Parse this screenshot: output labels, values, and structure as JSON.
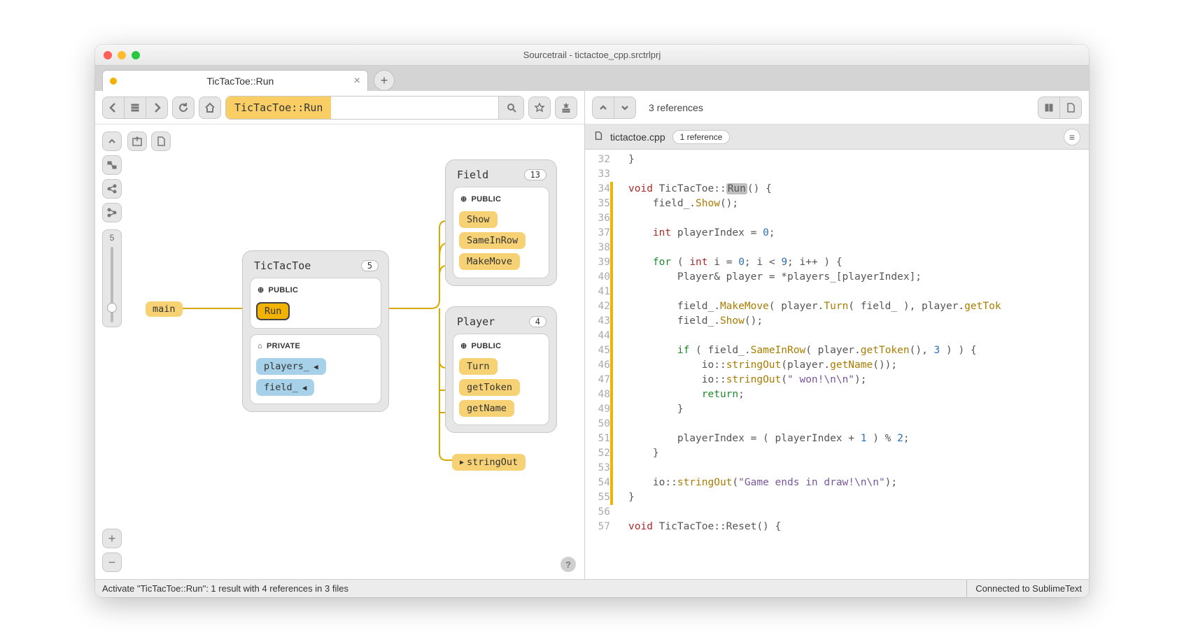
{
  "window": {
    "title": "Sourcetrail - tictactoe_cpp.srctrlprj"
  },
  "tab": {
    "label": "TicTacToe::Run"
  },
  "search": {
    "query": "TicTacToe::Run"
  },
  "slider": {
    "value": "5"
  },
  "refs": {
    "top": "3 references"
  },
  "file": {
    "name": "tictactoe.cpp",
    "chip": "1 reference"
  },
  "graph": {
    "entry": "main",
    "free": "stringOut",
    "tictactoe": {
      "title": "TicTacToe",
      "badge": "5",
      "public_label": "PUBLIC",
      "private_label": "PRIVATE",
      "run": "Run",
      "players": "players_",
      "field": "field_"
    },
    "field": {
      "title": "Field",
      "badge": "13",
      "public_label": "PUBLIC",
      "m0": "Show",
      "m1": "SameInRow",
      "m2": "MakeMove"
    },
    "player": {
      "title": "Player",
      "badge": "4",
      "public_label": "PUBLIC",
      "m0": "Turn",
      "m1": "getToken",
      "m2": "getName"
    }
  },
  "code": {
    "start": 32,
    "lines": [
      {
        "n": 32,
        "h": "}"
      },
      {
        "n": 33,
        "h": ""
      },
      {
        "n": 34,
        "mark": true,
        "h": "<span class='ty'>void</span> TicTacToe::<span class='hlword'>Run</span>() {"
      },
      {
        "n": 35,
        "mark": true,
        "h": "    field_.<span class='call'>Show</span>();"
      },
      {
        "n": 36,
        "mark": true,
        "h": ""
      },
      {
        "n": 37,
        "mark": true,
        "h": "    <span class='ty'>int</span> playerIndex = <span class='num'>0</span>;"
      },
      {
        "n": 38,
        "mark": true,
        "h": ""
      },
      {
        "n": 39,
        "mark": true,
        "h": "    <span class='kw'>for</span> ( <span class='ty'>int</span> i = <span class='num'>0</span>; i &lt; <span class='num'>9</span>; i++ ) {"
      },
      {
        "n": 40,
        "mark": true,
        "h": "        Player&amp; player = *players_[playerIndex];"
      },
      {
        "n": 41,
        "mark": true,
        "h": ""
      },
      {
        "n": 42,
        "mark": true,
        "h": "        field_.<span class='call'>MakeMove</span>( player.<span class='call'>Turn</span>( field_ ), player.<span class='call'>getTok</span>"
      },
      {
        "n": 43,
        "mark": true,
        "h": "        field_.<span class='call'>Show</span>();"
      },
      {
        "n": 44,
        "mark": true,
        "h": ""
      },
      {
        "n": 45,
        "mark": true,
        "h": "        <span class='kw'>if</span> ( field_.<span class='call'>SameInRow</span>( player.<span class='call'>getToken</span>(), <span class='num'>3</span> ) ) {"
      },
      {
        "n": 46,
        "mark": true,
        "h": "            io::<span class='call'>stringOut</span>(player.<span class='call'>getName</span>());"
      },
      {
        "n": 47,
        "mark": true,
        "h": "            io::<span class='call'>stringOut</span>(<span class='str'>\" won!\\n\\n\"</span>);"
      },
      {
        "n": 48,
        "mark": true,
        "h": "            <span class='kw'>return</span>;"
      },
      {
        "n": 49,
        "mark": true,
        "h": "        }"
      },
      {
        "n": 50,
        "mark": true,
        "h": ""
      },
      {
        "n": 51,
        "mark": true,
        "h": "        playerIndex = ( playerIndex + <span class='num'>1</span> ) % <span class='num'>2</span>;"
      },
      {
        "n": 52,
        "mark": true,
        "h": "    }"
      },
      {
        "n": 53,
        "mark": true,
        "h": ""
      },
      {
        "n": 54,
        "mark": true,
        "h": "    io::<span class='call'>stringOut</span>(<span class='str'>\"Game ends in draw!\\n\\n\"</span>);"
      },
      {
        "n": 55,
        "mark": true,
        "h": "}"
      },
      {
        "n": 56,
        "h": ""
      },
      {
        "n": 57,
        "h": "<span class='ty'>void</span> TicTacToe::Reset() {"
      }
    ]
  },
  "status": {
    "left": "Activate \"TicTacToe::Run\": 1 result with 4 references in 3 files",
    "right": "Connected to SublimeText"
  }
}
